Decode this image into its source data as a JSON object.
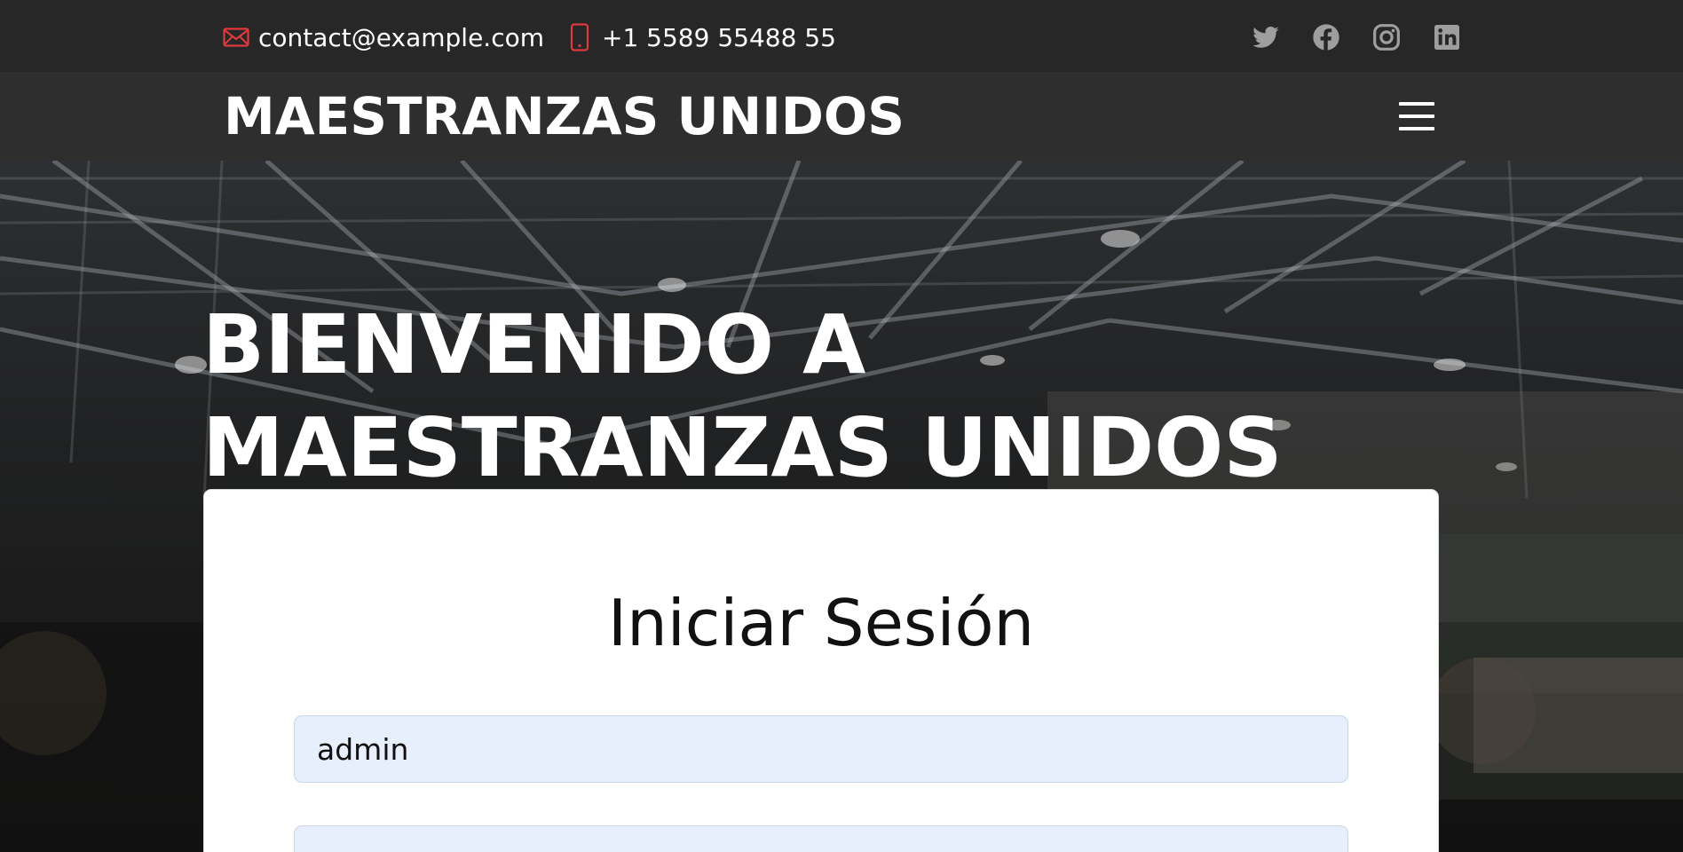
{
  "topbar": {
    "email": "contact@example.com",
    "phone": "+1 5589 55488 55",
    "social": [
      "twitter-icon",
      "facebook-icon",
      "instagram-icon",
      "linkedin-icon"
    ],
    "accent_color": "#e03a3e"
  },
  "navbar": {
    "brand": "MAESTRANZAS UNIDOS",
    "menu_icon": "hamburger-menu-icon"
  },
  "hero": {
    "title_line1": "BIENVENIDO A",
    "title_line2": "MAESTRANZAS UNIDOS"
  },
  "login": {
    "title": "Iniciar Sesión",
    "username_value": "admin",
    "password_value": ""
  }
}
